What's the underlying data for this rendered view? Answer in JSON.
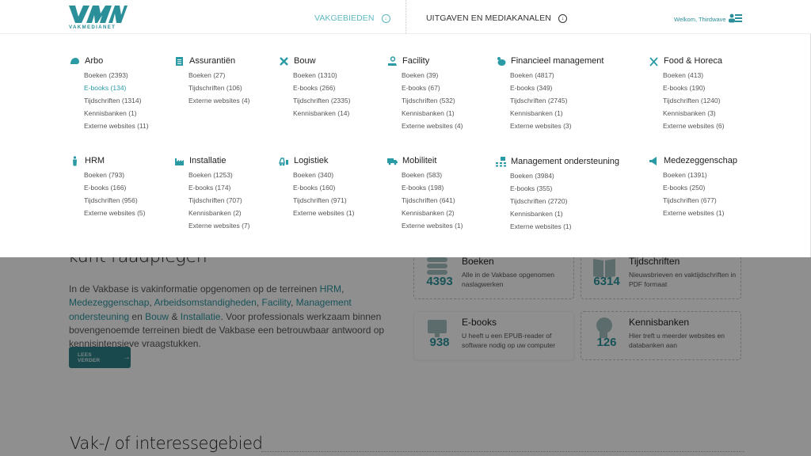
{
  "header": {
    "logo_text": "VMN",
    "logo_sub": "VAKMEDIANET",
    "nav": [
      {
        "label": "VAKGEBIEDEN",
        "active": true
      },
      {
        "label": "UITGAVEN EN MEDIAKANALEN",
        "active": false
      }
    ],
    "welcome": "Welkom, Thirdwave",
    "accent_color": "#2a8f98"
  },
  "mega_menu": {
    "categories": [
      {
        "name": "Arbo",
        "icon": "helmet-icon",
        "links": [
          "Boeken (2393)",
          "E-books (134)",
          "Tijdschriften (1314)",
          "Kennisbanken (1)",
          "Externe websites (11)"
        ],
        "active_index": 1
      },
      {
        "name": "Assurantiën",
        "icon": "clipboard-icon",
        "links": [
          "Boeken (27)",
          "Tijdschriften (106)",
          "Externe websites (4)"
        ]
      },
      {
        "name": "Bouw",
        "icon": "tools-icon",
        "links": [
          "Boeken (1310)",
          "E-books  (266)",
          "Tijdschriften (2335)",
          "Kennisbanken (14)"
        ]
      },
      {
        "name": "Facility",
        "icon": "service-hand-icon",
        "links": [
          "Boeken (39)",
          "E-books  (67)",
          "Tijdschriften (532)",
          "Kennisbanken (1)",
          "Externe websites (4)"
        ]
      },
      {
        "name": "Financieel management",
        "icon": "piggy-bank-icon",
        "links": [
          "Boeken (4817)",
          "E-books  (349)",
          "Tijdschriften (2745)",
          "Kennisbanken (1)",
          "Externe websites (3)"
        ]
      },
      {
        "name": "Food & Horeca",
        "icon": "cutlery-icon",
        "links": [
          "Boeken (413)",
          "E-books  (190)",
          "Tijdschriften (1240)",
          "Kennisbanken (3)",
          "Externe websites (6)"
        ]
      },
      {
        "name": "HRM",
        "icon": "person-tie-icon",
        "links": [
          "Boeken (793)",
          "E-books  (166)",
          "Tijdschriften (956)",
          "Externe websites (5)"
        ]
      },
      {
        "name": "Installatie",
        "icon": "factory-icon",
        "links": [
          "Boeken (1253)",
          "E-books  (174)",
          "Tijdschriften (707)",
          "Kennisbanken (2)",
          "Externe websites (7)"
        ]
      },
      {
        "name": "Logistiek",
        "icon": "forklift-icon",
        "links": [
          "Boeken (340)",
          "E-books  (160)",
          "Tijdschriften (971)",
          "Externe websites (1)"
        ]
      },
      {
        "name": "Mobiliteit",
        "icon": "truck-icon",
        "links": [
          "Boeken (583)",
          "E-books  (198)",
          "Tijdschriften (641)",
          "Kennisbanken (2)",
          "Externe websites (1)"
        ]
      },
      {
        "name": "Management ondersteuning",
        "icon": "org-chart-icon",
        "links": [
          "Boeken (3984)",
          "E-books  (355)",
          "Tijdschriften (2720)",
          "Kennisbanken (1)",
          "Externe websites (1)"
        ]
      },
      {
        "name": "Medezeggenschap",
        "icon": "megaphone-icon",
        "links": [
          "Boeken (1391)",
          "E-books  (250)",
          "Tijdschriften (677)",
          "Externe websites (1)"
        ]
      }
    ]
  },
  "page": {
    "hero_title_tail": "kunt raadplegen",
    "intro": {
      "p1": "In de Vakbase is vakinformatie opgenomen op de terreinen ",
      "l1": "HRM",
      "s1": ", ",
      "l2": "Medezeggenschap",
      "s2": ", ",
      "l3": "Arbeidsomstandigheden",
      "s3": ", ",
      "l4": "Facility",
      "s4": ", ",
      "l5": "Management ondersteuning",
      "s5": " en ",
      "l6": "Bouw",
      "s6": " & ",
      "l7": "Installatie",
      "p2": ". Voor professionals werkzaam binnen bovengenoemde terreinen biedt de Vakbase een betrouwbaar antwoord op kennisintensieve vraagstukken."
    },
    "read_more": "LEES VERDER",
    "cards": [
      {
        "title": "Boeken",
        "count": "4393",
        "desc": "Alle in de Vakbase opgenomen naslagwerken"
      },
      {
        "title": "Tijdschriften",
        "count": "6314",
        "desc": "Nieuwsbrieven en vaktijdschriften in PDF formaat"
      },
      {
        "title": "E-books",
        "count": "938",
        "desc": "U heeft u een EPUB-reader of software nodig op uw computer"
      },
      {
        "title": "Kennisbanken",
        "count": "126",
        "desc": "Hier treft u meerder websites en databanken aan"
      }
    ],
    "section_title": "Vak-/ of interessegebied"
  }
}
